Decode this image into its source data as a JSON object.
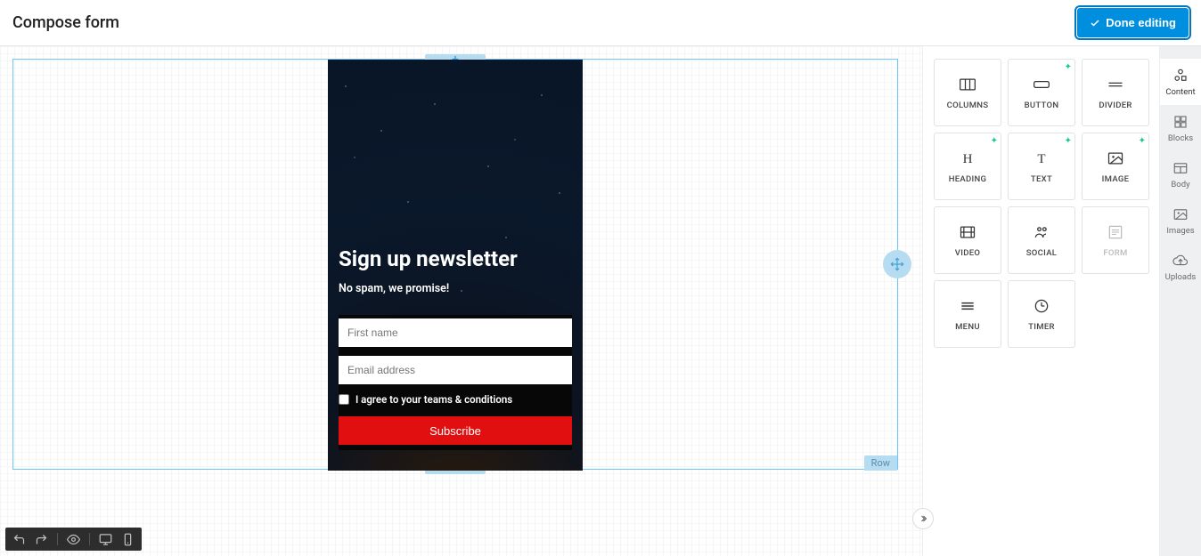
{
  "header": {
    "title": "Compose form",
    "done_label": "Done editing"
  },
  "canvas": {
    "row_label": "Row",
    "form": {
      "heading": "Sign up newsletter",
      "tagline": "No spam, we promise!",
      "first_name_placeholder": "First name",
      "email_placeholder": "Email address",
      "agree_label": "I agree to your teams & conditions",
      "submit_label": "Subscribe"
    }
  },
  "tools": [
    {
      "key": "columns",
      "label": "COLUMNS",
      "ai": false
    },
    {
      "key": "button",
      "label": "BUTTON",
      "ai": true
    },
    {
      "key": "divider",
      "label": "DIVIDER",
      "ai": false
    },
    {
      "key": "heading",
      "label": "HEADING",
      "ai": true
    },
    {
      "key": "text",
      "label": "TEXT",
      "ai": true
    },
    {
      "key": "image",
      "label": "IMAGE",
      "ai": true
    },
    {
      "key": "video",
      "label": "VIDEO",
      "ai": false
    },
    {
      "key": "social",
      "label": "SOCIAL",
      "ai": false
    },
    {
      "key": "form",
      "label": "FORM",
      "ai": false,
      "disabled": true
    },
    {
      "key": "menu",
      "label": "MENU",
      "ai": false
    },
    {
      "key": "timer",
      "label": "TIMER",
      "ai": false
    }
  ],
  "side_tabs": [
    {
      "key": "content",
      "label": "Content",
      "active": true
    },
    {
      "key": "blocks",
      "label": "Blocks",
      "active": false
    },
    {
      "key": "body",
      "label": "Body",
      "active": false
    },
    {
      "key": "images",
      "label": "Images",
      "active": false
    },
    {
      "key": "uploads",
      "label": "Uploads",
      "active": false
    }
  ]
}
